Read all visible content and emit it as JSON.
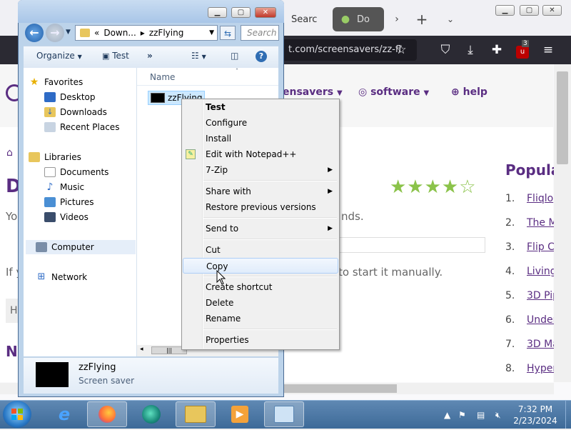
{
  "firefox": {
    "tabs": [
      {
        "label": "Searc"
      },
      {
        "label": "Do"
      }
    ],
    "url": "t.com/screensavers/zz-fl",
    "nav": {
      "screensavers_label": "ensavers",
      "software_label": "software",
      "help_label": "help"
    },
    "heading": "D",
    "text_fragments": {
      "line1_left": "Yo",
      "line1_right": "nds.",
      "line2_left": "If y",
      "line2_right": "to start it manually.",
      "line3_left": "H",
      "heading2": "N"
    },
    "popular": {
      "title": "Popula",
      "items": [
        {
          "num": "1.",
          "label": "Fliqlo"
        },
        {
          "num": "2.",
          "label": "The M"
        },
        {
          "num": "3.",
          "label": "Flip C"
        },
        {
          "num": "4.",
          "label": "Living"
        },
        {
          "num": "5.",
          "label": "3D Pip"
        },
        {
          "num": "6.",
          "label": "Under"
        },
        {
          "num": "7.",
          "label": "3D Ma"
        },
        {
          "num": "8.",
          "label": "Hyper"
        }
      ]
    },
    "rating_stars": 4.5,
    "ublock_badge": "3",
    "colors": {
      "accent": "#5a2d82",
      "stars": "#8bc34a"
    }
  },
  "explorer": {
    "breadcrumb": [
      "«",
      "Down...",
      "zzFlying"
    ],
    "search_placeholder": "Search z",
    "toolbar": {
      "organize": "Organize",
      "test": "Test",
      "more": "»"
    },
    "nav": {
      "favorites": "Favorites",
      "desktop": "Desktop",
      "downloads": "Downloads",
      "recent": "Recent Places",
      "libraries": "Libraries",
      "documents": "Documents",
      "music": "Music",
      "pictures": "Pictures",
      "videos": "Videos",
      "computer": "Computer",
      "network": "Network"
    },
    "column_name": "Name",
    "file_name": "zzFlying",
    "details": {
      "name": "zzFlying",
      "type": "Screen saver"
    }
  },
  "context_menu": {
    "items": [
      {
        "label": "Test",
        "bold": true
      },
      {
        "label": "Configure"
      },
      {
        "label": "Install"
      },
      {
        "label": "Edit with Notepad++"
      },
      {
        "label": "7-Zip"
      },
      {
        "label": "Share with"
      },
      {
        "label": "Restore previous versions"
      },
      {
        "label": "Send to"
      },
      {
        "label": "Cut"
      },
      {
        "label": "Copy"
      },
      {
        "label": "Create shortcut"
      },
      {
        "label": "Delete"
      },
      {
        "label": "Rename"
      },
      {
        "label": "Properties"
      }
    ]
  },
  "taskbar": {
    "time": "7:32 PM",
    "date": "2/23/2024"
  }
}
